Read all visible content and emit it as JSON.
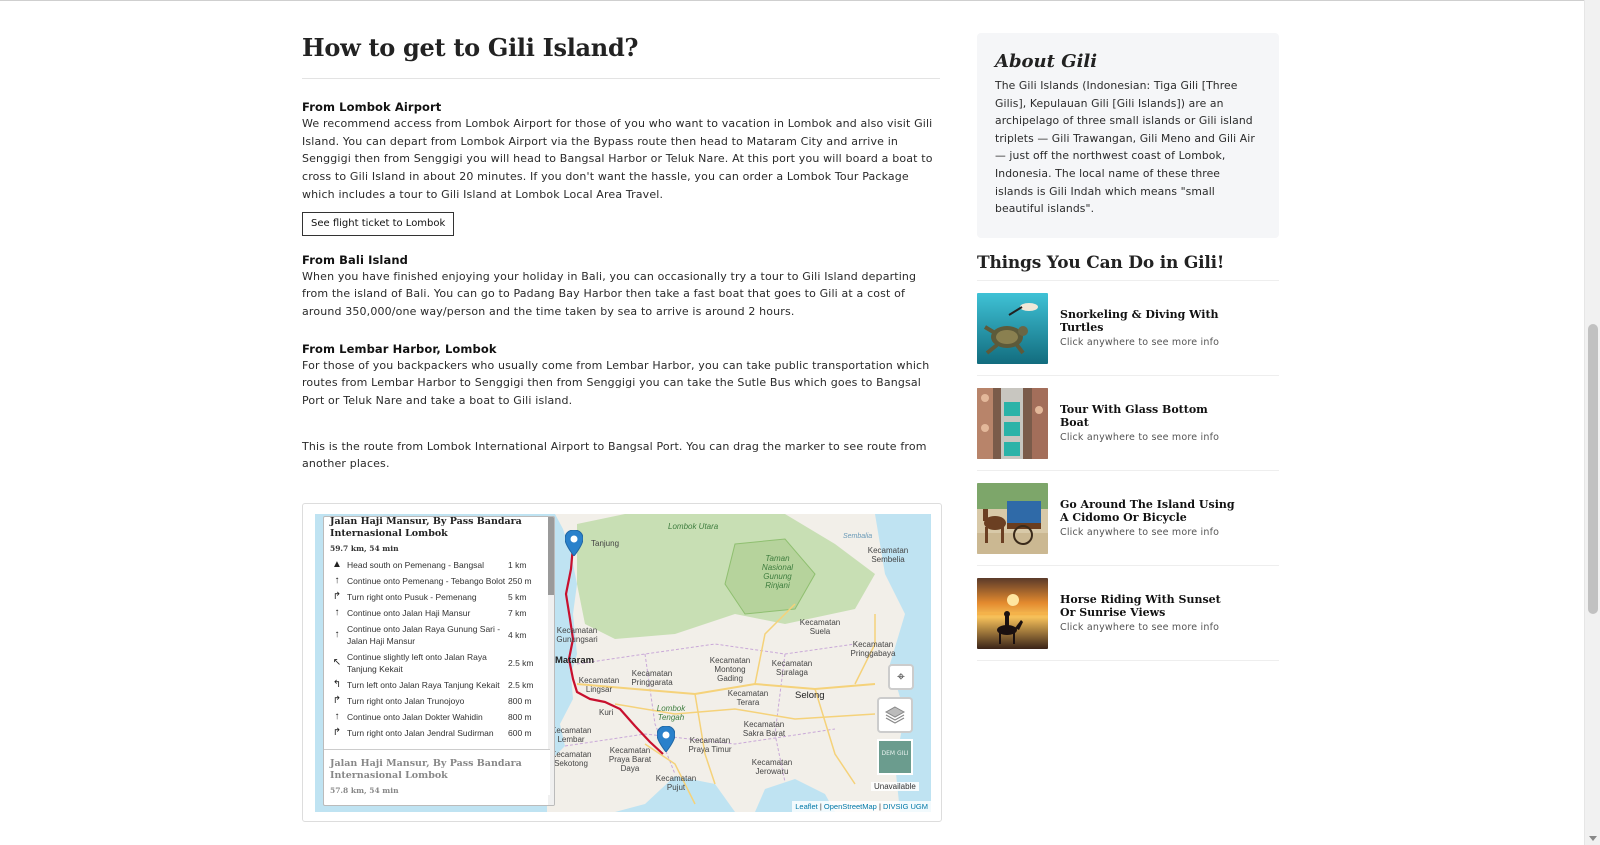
{
  "main": {
    "title": "How to get to Gili Island?",
    "sections": [
      {
        "title": "From Lombok Airport",
        "text": "We recommend access from Lombok Airport for those of you who want to vacation in Lombok and also visit Gili Island. You can depart from Lombok Airport via the Bypass route then head to Mataram City and arrive in Senggigi then from Senggigi you will head to Bangsal Harbor or Teluk Nare. At this port you will board a boat to cross to Gili Island in about 20 minutes. If you don't want the hassle, you can order a Lombok Tour Package which includes a tour to Gili Island at Lombok Local Area Travel.",
        "button": "See flight ticket to Lombok"
      },
      {
        "title": "From Bali Island",
        "text": "When you have finished enjoying your holiday in Bali, you can occasionally try a tour to Gili Island departing from the island of Bali. You can go to Padang Bay Harbor then take a fast boat that goes to Gili at a cost of around 350,000/one way/person and the time taken by sea to arrive is around 2 hours."
      },
      {
        "title": "From Lembar Harbor, Lombok",
        "text": "For those of you backpackers who usually come from Lembar Harbor, you can take public transportation which routes from Lembar Harbor to Senggigi then from Senggigi you can take the Sutle Bus which goes to Bangsal Port or Teluk Nare and take a boat to Gili island."
      }
    ],
    "route_text": "This is the route from Lombok International Airport to Bangsal Port. You can drag the marker to see route from another places."
  },
  "map": {
    "route_title": "Jalan Haji Mansur, By Pass Bandara Internasional Lombok",
    "route_summary": "59.7 km, 54 min",
    "steps": [
      {
        "icon": "depart-icon",
        "glyph": "▲",
        "text": "Head south on Pemenang - Bangsal",
        "distance": "1 km"
      },
      {
        "icon": "straight-icon",
        "glyph": "↑",
        "text": "Continue onto Pemenang - Tebango Bolot",
        "distance": "250 m"
      },
      {
        "icon": "turn-right-icon",
        "glyph": "↱",
        "text": "Turn right onto Pusuk - Pemenang",
        "distance": "5 km"
      },
      {
        "icon": "straight-icon",
        "glyph": "↑",
        "text": "Continue onto Jalan Haji Mansur",
        "distance": "7 km"
      },
      {
        "icon": "straight-icon",
        "glyph": "↑",
        "text": "Continue onto Jalan Raya Gunung Sari - Jalan Haji Mansur",
        "distance": "4 km"
      },
      {
        "icon": "slight-left-icon",
        "glyph": "↖",
        "text": "Continue slightly left onto Jalan Raya Tanjung Kekait",
        "distance": "2.5 km"
      },
      {
        "icon": "turn-left-icon",
        "glyph": "↰",
        "text": "Turn left onto Jalan Raya Tanjung Kekait",
        "distance": "2.5 km"
      },
      {
        "icon": "turn-right-icon",
        "glyph": "↱",
        "text": "Turn right onto Jalan Trunojoyo",
        "distance": "800 m"
      },
      {
        "icon": "straight-icon",
        "glyph": "↑",
        "text": "Continue onto Jalan Dokter Wahidin",
        "distance": "800 m"
      },
      {
        "icon": "turn-right-icon",
        "glyph": "↱",
        "text": "Turn right onto Jalan Jendral Sudirman",
        "distance": "600 m"
      }
    ],
    "alt_route_title": "Jalan Haji Mansur, By Pass Bandara Internasional Lombok",
    "alt_route_summary": "57.8 km, 54 min",
    "layer_tile_label": "DEM GILI",
    "unavailable": "Unavailable",
    "attribution": {
      "leaflet": "Leaflet",
      "sep": " | ",
      "osm": "OpenStreetMap",
      "divsig": "DIVSIG UGM"
    },
    "labels": {
      "lombok_utara": "Lombok Utara",
      "tanjung": "Tanjung",
      "sembalia": "Sembalia",
      "kecamatan_sembelia": "Kecamatan Sembelia",
      "taman_nasional": "Taman Nasional Gunung Rinjani",
      "kecamatan_suela": "Kecamatan Suela",
      "kecamatan_pringgabaya": "Kecamatan Pringgabaya",
      "mataram": "Mataram",
      "kecamatan_gunungsari": "Kecamatan Gunungsari",
      "kecamatan_lingsar": "Kecamatan Lingsar",
      "kecamatan_pringgarata": "Kecamatan Pringgarata",
      "kecamatan_montong_gading": "Kecamatan Montong Gading",
      "kecamatan_suralaga": "Kecamatan Suralaga",
      "selong": "Selong",
      "kecamatan_terara": "Kecamatan Terara",
      "lombok_tengah": "Lombok Tengah",
      "kecamatan_lembar": "Kecamatan Lembar",
      "kecamatan_sekotong": "Kecamatan Sekotong",
      "kecamatan_praya_barat_daya": "Kecamatan Praya Barat Daya",
      "kecamatan_praya_timur": "Kecamatan Praya Timur",
      "kecamatan_sakra_barat": "Kecamatan Sakra Barat",
      "kecamatan_jerowaru": "Kecamatan Jerowaru",
      "kecamatan_pujut": "Kecamatan Pujut",
      "kuripan": "Kuri",
      "tamanhaji": "Tamanhaji",
      "kediri": "Kediri",
      "pemenang": "Pemenang"
    }
  },
  "sidebar": {
    "about_title": "About Gili",
    "about_text": "The Gili Islands (Indonesian: Tiga Gili [Three Gilis], Kepulauan Gili [Gili Islands]) are an archipelago of three small islands or Gili island triplets — Gili Trawangan, Gili Meno and Gili Air — just off the northwest coast of Lombok, Indonesia. The local name of these three islands is Gili Indah which means \"small beautiful islands\".",
    "things_title": "Things You Can Do in Gili!",
    "things": [
      {
        "name": "Snorkeling & Diving With Turtles",
        "sub": "Click anywhere to see more info"
      },
      {
        "name": "Tour With Glass Bottom Boat",
        "sub": "Click anywhere to see more info"
      },
      {
        "name": "Go Around The Island Using A Cidomo Or Bicycle",
        "sub": "Click anywhere to see more info"
      },
      {
        "name": "Horse Riding With Sunset Or Sunrise Views",
        "sub": "Click anywhere to see more info"
      }
    ]
  }
}
